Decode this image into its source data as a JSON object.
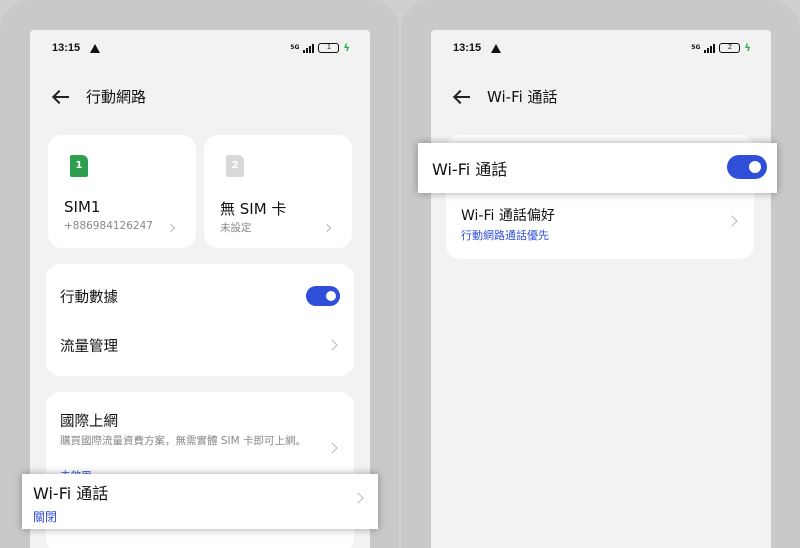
{
  "status_bar": {
    "time": "13:15",
    "signal_text": "5G",
    "battery_left": "1",
    "battery_right": "2"
  },
  "left_screen": {
    "title": "行動網路",
    "sim1": {
      "icon_label": "1",
      "name": "SIM1",
      "number": "+886984126247"
    },
    "sim2": {
      "icon_label": "2",
      "name": "無 SIM 卡",
      "status": "未設定"
    },
    "mobile_data": {
      "label": "行動數據",
      "enabled": true
    },
    "data_usage": {
      "label": "流量管理"
    },
    "roaming": {
      "title": "國際上網",
      "description": "購買國際流量資費方案，無需實體 SIM 卡即可上網。",
      "status": "未啟用"
    },
    "wifi_calling": {
      "title": "Wi-Fi 通話",
      "status": "關閉"
    }
  },
  "right_screen": {
    "title": "Wi-Fi 通話",
    "wifi_calling_toggle": {
      "label": "Wi-Fi 通話",
      "enabled": true
    },
    "preference": {
      "label": "Wi-Fi 通話偏好",
      "value": "行動網路通話優先"
    }
  },
  "colors": {
    "accent": "#2f4fd8",
    "sim_active": "#2e9e4f",
    "charging": "#2bb24c"
  },
  "icons": [
    "back-arrow-icon",
    "warning-icon",
    "signal-icon",
    "battery-icon",
    "charging-bolt-icon",
    "chevron-right-icon",
    "sim-card-icon"
  ]
}
